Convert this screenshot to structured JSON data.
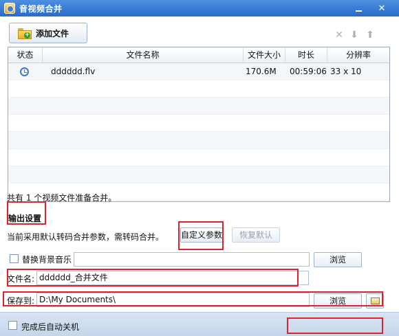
{
  "window": {
    "title": "音视频合并"
  },
  "toolbar": {
    "add_file_label": "添加文件",
    "delete_icon": "close-icon",
    "down_icon": "arrow-down-icon",
    "up_icon": "arrow-up-icon"
  },
  "table": {
    "columns": [
      "状态",
      "文件名称",
      "文件大小",
      "时长",
      "分辨率"
    ],
    "rows": [
      {
        "status_icon": "clock-icon",
        "name": "dddddd.flv",
        "size": "170.6M",
        "duration": "00:59:06",
        "resolution": "33 x 10"
      }
    ]
  },
  "summary": "共有 1 个视频文件准备合并。",
  "output": {
    "section_title": "输出设置",
    "current_setting": "当前采用默认转码合并参数，需转码合并。",
    "custom_button": "自定义参数",
    "reset_button": "恢复默认"
  },
  "music": {
    "label": "替换背景音乐",
    "value": "",
    "browse_button": "浏览"
  },
  "filename": {
    "label": "文件名:",
    "value": "dddddd_合并文件"
  },
  "savepath": {
    "label": "保存到:",
    "value": "D:\\My Documents\\",
    "browse_button": "浏览"
  },
  "footer": {
    "shutdown_label": "完成后自动关机"
  },
  "colors": {
    "titlebar": "#2a6cc7",
    "annotation_red": "#e0202a",
    "footer": "#c5d6ea"
  }
}
